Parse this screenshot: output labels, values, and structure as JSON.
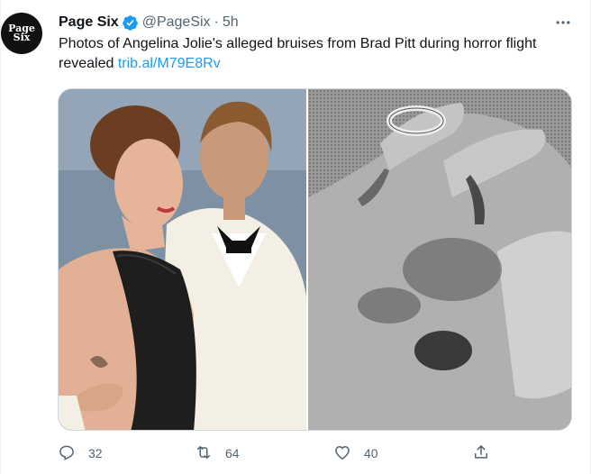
{
  "author": {
    "avatar_text_line1": "Page",
    "avatar_text_line2": "Six",
    "display_name": "Page Six",
    "handle": "@PageSix",
    "separator": "·",
    "time": "5h"
  },
  "tweet": {
    "text": "Photos of Angelina Jolie's alleged bruises from Brad Pitt during horror flight revealed ",
    "link": "trib.al/M79E8Rv"
  },
  "media": {
    "images": [
      {
        "icon": "photo-couple-red-carpet"
      },
      {
        "icon": "photo-bruised-hand-grayscale"
      }
    ]
  },
  "actions": {
    "reply_count": "32",
    "retweet_count": "64",
    "like_count": "40"
  },
  "colors": {
    "accent": "#1d9bf0",
    "text": "#0f1419",
    "secondary": "#536471"
  }
}
